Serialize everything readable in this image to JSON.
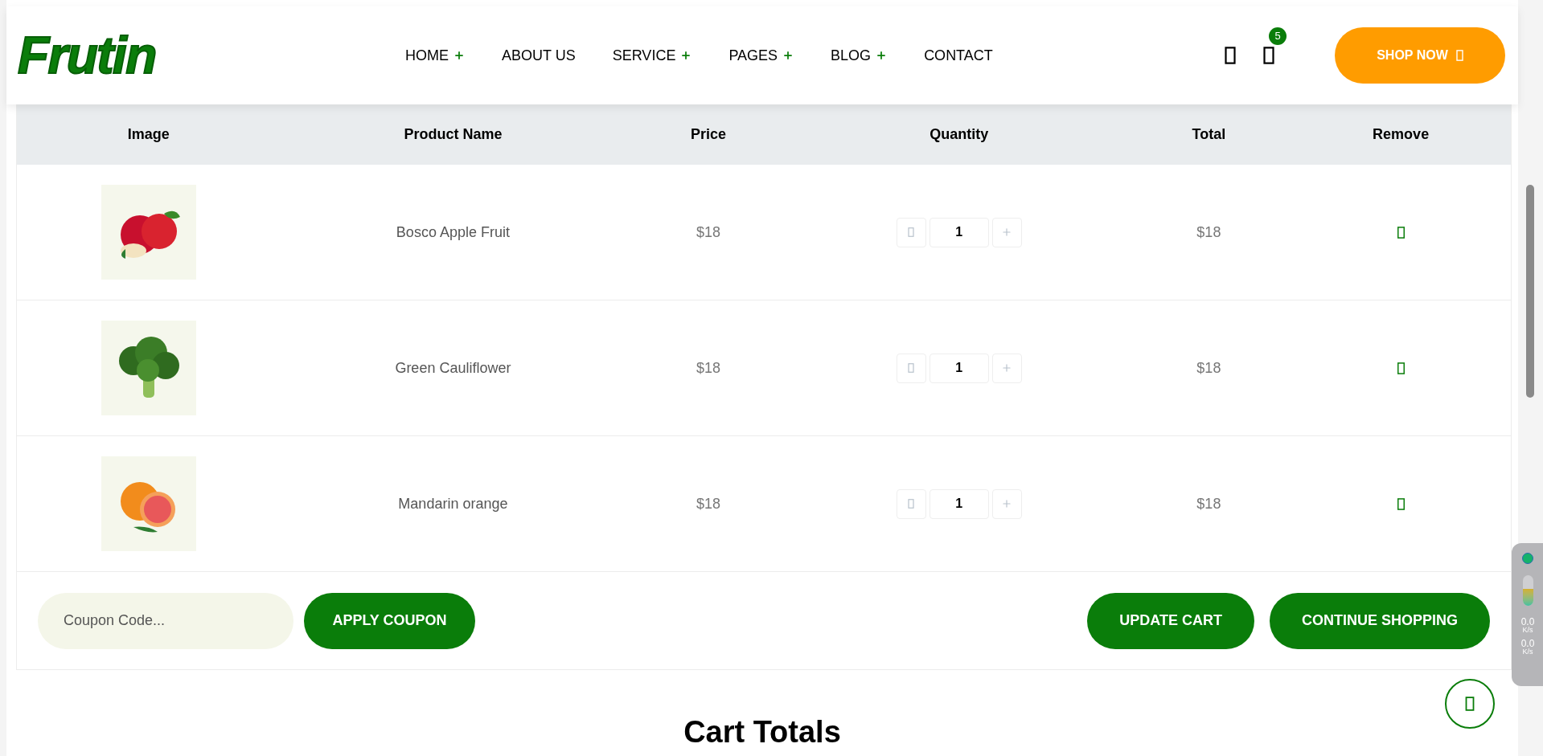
{
  "header": {
    "logo": "Frutin",
    "nav": [
      {
        "label": "HOME",
        "has_dropdown": true
      },
      {
        "label": "ABOUT US",
        "has_dropdown": false
      },
      {
        "label": "SERVICE",
        "has_dropdown": true
      },
      {
        "label": "PAGES",
        "has_dropdown": true
      },
      {
        "label": "BLOG",
        "has_dropdown": true
      },
      {
        "label": "CONTACT",
        "has_dropdown": false
      }
    ],
    "cart_count": "5",
    "shop_button": "SHOP NOW"
  },
  "table": {
    "columns": [
      "Image",
      "Product Name",
      "Price",
      "Quantity",
      "Total",
      "Remove"
    ],
    "rows": [
      {
        "kind": "apple",
        "name": "Bosco Apple Fruit",
        "price": "$18",
        "quantity": "1",
        "total": "$18"
      },
      {
        "kind": "broccoli",
        "name": "Green Cauliflower",
        "price": "$18",
        "quantity": "1",
        "total": "$18"
      },
      {
        "kind": "orange",
        "name": "Mandarin orange",
        "price": "$18",
        "quantity": "1",
        "total": "$18"
      }
    ]
  },
  "coupon": {
    "placeholder": "Coupon Code...",
    "apply_button": "APPLY COUPON"
  },
  "actions": [
    "UPDATE CART",
    "CONTINUE SHOPPING"
  ],
  "cart_totals_title": "Cart Totals",
  "speed_widget": {
    "upload": "0.0",
    "upload_unit": "K/s",
    "download": "0.0",
    "download_unit": "K/s",
    "level": 0.55
  }
}
